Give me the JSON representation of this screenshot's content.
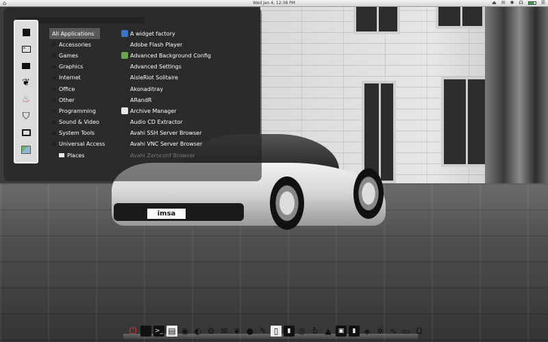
{
  "top_panel": {
    "clock": "Wed Jan 4, 12:38 PM",
    "tray": [
      "⏏",
      "✉",
      "✱",
      "☊",
      "☰"
    ]
  },
  "launcher": {
    "categories": [
      {
        "label": "All Applications",
        "active": true
      },
      {
        "label": "Accessories"
      },
      {
        "label": "Games"
      },
      {
        "label": "Graphics"
      },
      {
        "label": "Internet"
      },
      {
        "label": "Office"
      },
      {
        "label": "Other"
      },
      {
        "label": "Programming"
      },
      {
        "label": "Sound & Video"
      },
      {
        "label": "System Tools"
      },
      {
        "label": "Universal Access"
      },
      {
        "label": "Places"
      }
    ],
    "apps": [
      {
        "label": "A widget factory",
        "color": "#3b73c9"
      },
      {
        "label": "Adobe Flash Player",
        "color": "#2a2a2a"
      },
      {
        "label": "Advanced Background Config",
        "color": "#6aa84f"
      },
      {
        "label": "Advanced Settings",
        "color": "#2a2a2a"
      },
      {
        "label": "AisleRiot Solitaire",
        "color": "#2a2a2a"
      },
      {
        "label": "Akonaditray",
        "color": "#2a2a2a"
      },
      {
        "label": "ARandR",
        "color": "#2a2a2a"
      },
      {
        "label": "Archive Manager",
        "color": "#e8e8e8"
      },
      {
        "label": "Audio CD Extractor",
        "color": "#2a2a2a"
      },
      {
        "label": "Avahi SSH Server Browser",
        "color": "#2a2a2a"
      },
      {
        "label": "Avahi VNC Server Browser",
        "color": "#2a2a2a"
      },
      {
        "label": "Avahi Zeroconf Browser",
        "color": "#2a2a2a",
        "faded": true
      }
    ],
    "sidebar_icons": [
      "stop-icon",
      "terminal-icon",
      "mail-icon",
      "chat-icon",
      "document-icon",
      "share-icon",
      "film-icon",
      "network-icon"
    ]
  },
  "wallpaper": {
    "plate_text": "imsa"
  },
  "dock": {
    "items": [
      {
        "name": "power-icon",
        "glyph": "⏻"
      },
      {
        "name": "square-app-icon",
        "glyph": ""
      },
      {
        "name": "terminal-icon",
        "glyph": ">_"
      },
      {
        "name": "calendar-icon",
        "glyph": "▤"
      },
      {
        "name": "chrome-icon",
        "glyph": "◉"
      },
      {
        "name": "firefox-icon",
        "glyph": "◐"
      },
      {
        "name": "network-icon",
        "glyph": "⚙"
      },
      {
        "name": "mail-icon",
        "glyph": "✉"
      },
      {
        "name": "chat-icon",
        "glyph": "❦"
      },
      {
        "name": "speech-icon",
        "glyph": "●"
      },
      {
        "name": "pen-icon",
        "glyph": "✎"
      },
      {
        "name": "document-icon",
        "glyph": "▯"
      },
      {
        "name": "window-icon",
        "glyph": "▮"
      },
      {
        "name": "disc-icon",
        "glyph": "◎"
      },
      {
        "name": "bittorrent-icon",
        "glyph": "ɓ"
      },
      {
        "name": "vlc-icon",
        "glyph": "▲"
      },
      {
        "name": "monitor-icon",
        "glyph": "▣"
      },
      {
        "name": "trash-icon",
        "glyph": "▮"
      },
      {
        "name": "cube-icon",
        "glyph": "◈"
      },
      {
        "name": "settings-icon",
        "glyph": "✲"
      },
      {
        "name": "waveform-icon",
        "glyph": "∿"
      },
      {
        "name": "display-icon",
        "glyph": "▭"
      },
      {
        "name": "headphones-icon",
        "glyph": "Ω"
      }
    ]
  }
}
